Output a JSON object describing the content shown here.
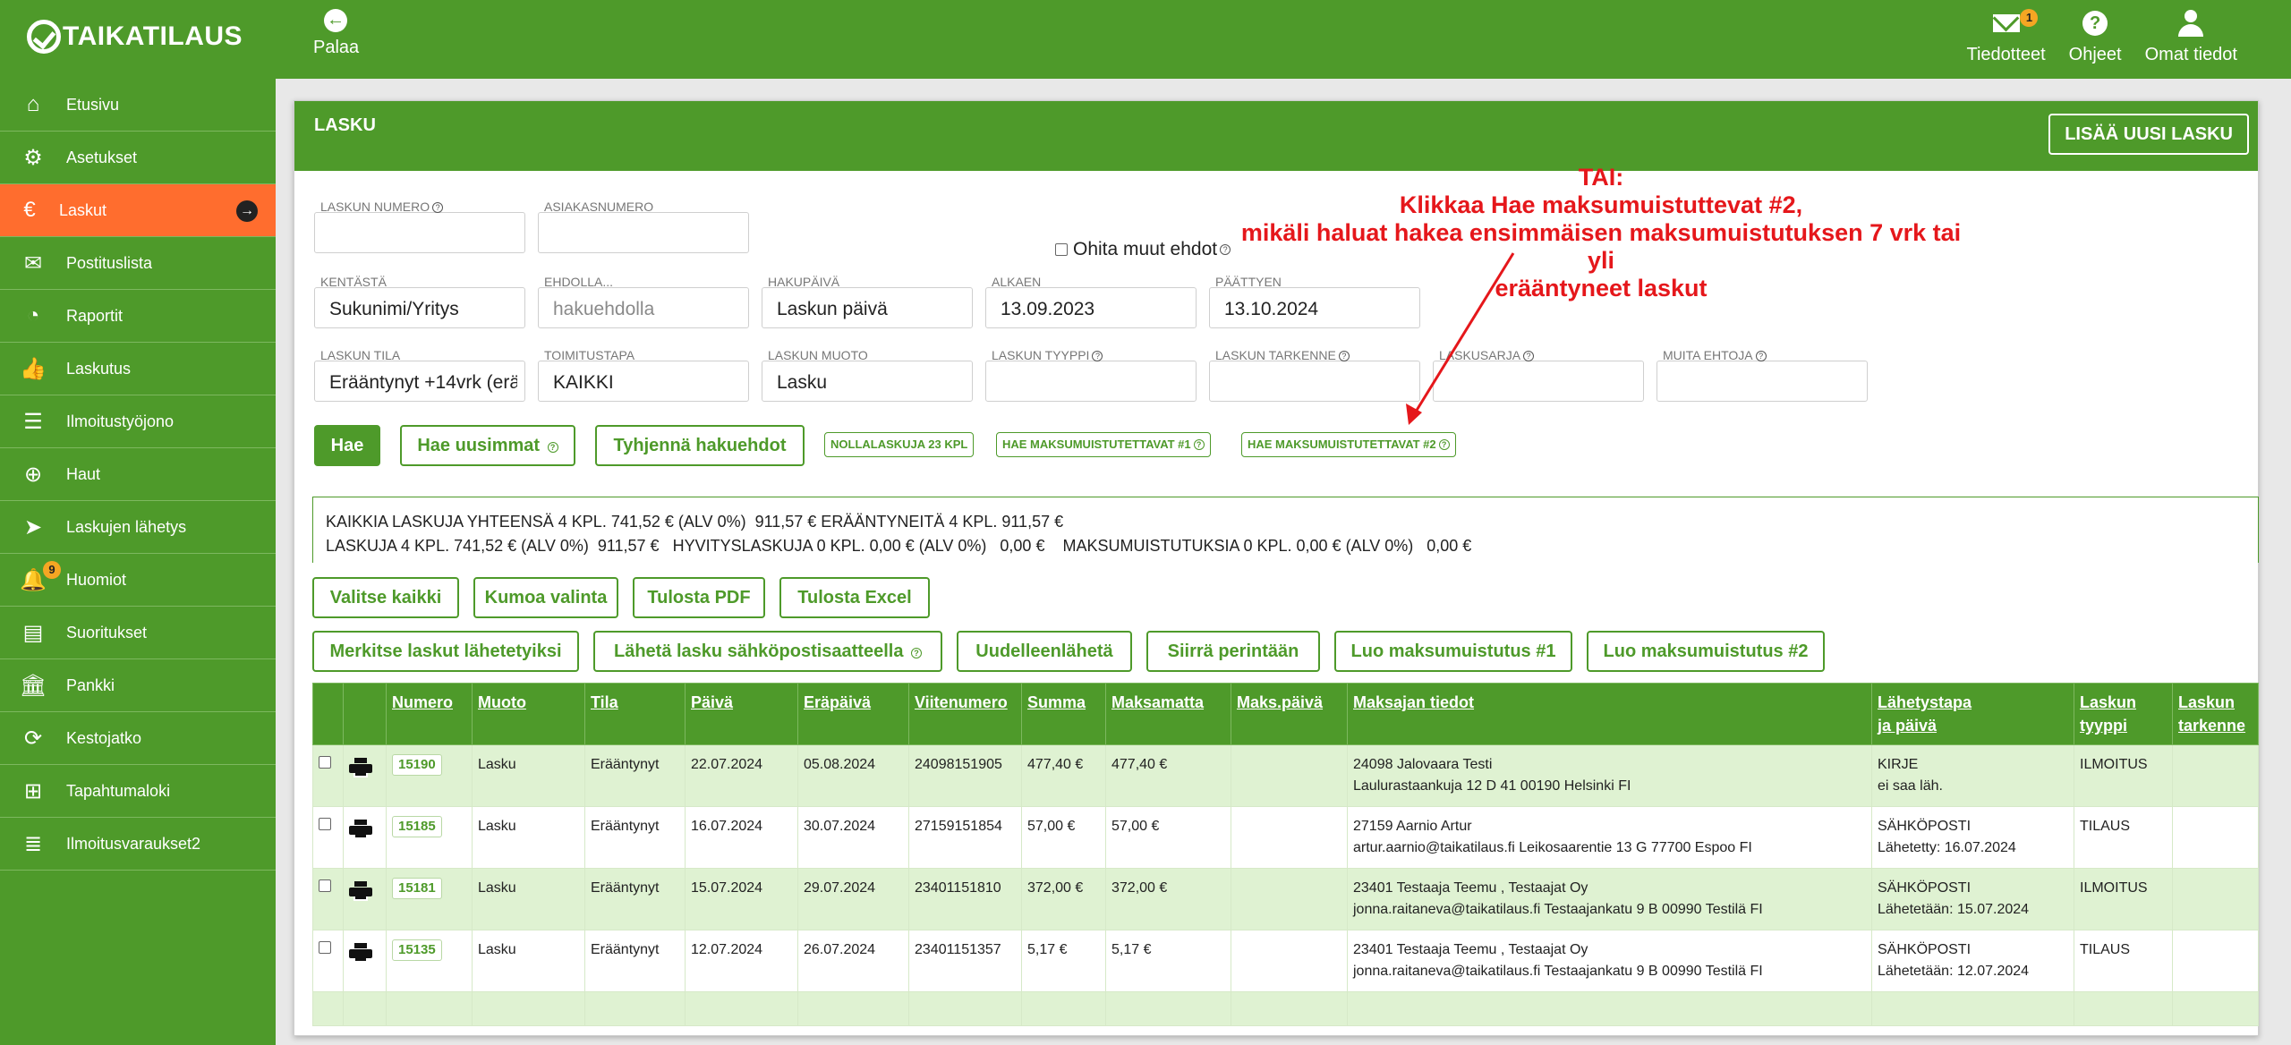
{
  "app": {
    "logo_text": "TAIKATILAUS"
  },
  "topbar": {
    "back_label": "Palaa",
    "actions": [
      {
        "label": "Tiedotteet",
        "icon": "mail-icon",
        "badge": "1"
      },
      {
        "label": "Ohjeet",
        "icon": "help-icon",
        "glyph": "?"
      },
      {
        "label": "Omat tiedot",
        "icon": "user-icon"
      }
    ]
  },
  "sidebar": {
    "items": [
      {
        "label": "Etusivu",
        "icon": "home-icon",
        "glyph": "⌂"
      },
      {
        "label": "Asetukset",
        "icon": "gear-icon",
        "glyph": "⚙"
      },
      {
        "label": "Laskut",
        "icon": "euro-icon",
        "glyph": "€",
        "active": true
      },
      {
        "label": "Postituslista",
        "icon": "envelope-icon",
        "glyph": "✉"
      },
      {
        "label": "Raportit",
        "icon": "pie-chart-icon",
        "glyph": "◔"
      },
      {
        "label": "Laskutus",
        "icon": "thumbs-up-icon",
        "glyph": "👍"
      },
      {
        "label": "Ilmoitustyöjono",
        "icon": "list-icon",
        "glyph": "☰"
      },
      {
        "label": "Haut",
        "icon": "search-plus-icon",
        "glyph": "⊕"
      },
      {
        "label": "Laskujen lähetys",
        "icon": "paper-plane-icon",
        "glyph": "➤"
      },
      {
        "label": "Huomiot",
        "icon": "bell-icon",
        "glyph": "🔔",
        "badge": "9"
      },
      {
        "label": "Suoritukset",
        "icon": "book-icon",
        "glyph": "▤"
      },
      {
        "label": "Pankki",
        "icon": "bank-icon",
        "glyph": "🏛"
      },
      {
        "label": "Kestojatko",
        "icon": "refresh-icon",
        "glyph": "⟳"
      },
      {
        "label": "Tapahtumaloki",
        "icon": "table-icon",
        "glyph": "⊞"
      },
      {
        "label": "Ilmoitusvaraukset2",
        "icon": "list-indent-icon",
        "glyph": "≣"
      }
    ]
  },
  "card": {
    "title": "LASKU",
    "add_button": "LISÄÄ UUSI LASKU"
  },
  "filters": {
    "laskun_numero": {
      "label": "LASKUN NUMERO",
      "value": ""
    },
    "asiakasnumero": {
      "label": "ASIAKASNUMERO",
      "value": ""
    },
    "ohita_label": "Ohita muut ehdot",
    "kentasta": {
      "label": "KENTÄSTÄ",
      "value": "Sukunimi/Yritys"
    },
    "ehdolla": {
      "label": "EHDOLLA...",
      "placeholder": "hakuehdolla"
    },
    "hakupaiva": {
      "label": "HAKUPÄIVÄ",
      "value": "Laskun päivä"
    },
    "alkaen": {
      "label": "ALKAEN",
      "value": "13.09.2023"
    },
    "paattyen": {
      "label": "PÄÄTTYEN",
      "value": "13.10.2024"
    },
    "laskun_tila": {
      "label": "LASKUN TILA",
      "value": "Erääntynyt +14vrk (erä"
    },
    "toimitustapa": {
      "label": "TOIMITUSTAPA",
      "value": "KAIKKI"
    },
    "laskun_muoto": {
      "label": "LASKUN MUOTO",
      "value": "Lasku"
    },
    "laskun_tyyppi": {
      "label": "LASKUN TYYPPI",
      "value": ""
    },
    "laskun_tarkenne": {
      "label": "LASKUN TARKENNE",
      "value": ""
    },
    "laskusarja": {
      "label": "LASKUSARJA",
      "value": ""
    },
    "muita_ehtoja": {
      "label": "MUITA EHTOJA",
      "value": ""
    }
  },
  "search_buttons": {
    "hae": "Hae",
    "hae_uusimmat": "Hae uusimmat",
    "tyhjenna": "Tyhjennä hakuehdot",
    "nollalaskuja": "NOLLALASKUJA 23 KPL",
    "muistutettavat1": "HAE MAKSUMUISTUTETTAVAT #1",
    "muistutettavat2": "HAE MAKSUMUISTUTETTAVAT #2"
  },
  "annotation": {
    "line1": "TAI:",
    "line2": "Klikkaa Hae maksumuistuttevat #2,",
    "line3": "mikäli haluat hakea ensimmäisen maksumuistutuksen 7 vrk tai yli",
    "line4": "erääntyneet laskut",
    "color": "#e5171b"
  },
  "summary": {
    "line1": "KAIKKIA LASKUJA YHTEENSÄ 4 KPL. 741,52 € (ALV 0%)  911,57 € ERÄÄNTYNEITÄ 4 KPL. 911,57 €",
    "line2": "LASKUJA 4 KPL. 741,52 € (ALV 0%)  911,57 €   HYVITYSLASKUJA 0 KPL. 0,00 € (ALV 0%)   0,00 €    MAKSUMUISTUTUKSIA 0 KPL. 0,00 € (ALV 0%)   0,00 €"
  },
  "actions_row1": {
    "valitse": "Valitse kaikki",
    "kumoa": "Kumoa valinta",
    "pdf": "Tulosta PDF",
    "excel": "Tulosta Excel"
  },
  "actions_row2": {
    "merkitse": "Merkitse laskut lähetetyiksi",
    "laheta": "Lähetä lasku sähköpostisaatteella",
    "uudelleen": "Uudelleenlähetä",
    "siirra": "Siirrä perintään",
    "luo1": "Luo maksumuistutus #1",
    "luo2": "Luo maksumuistutus #2"
  },
  "table": {
    "headers": {
      "numero": "Numero",
      "muoto": "Muoto",
      "tila": "Tila",
      "paiva": "Päivä",
      "erapaiva": "Eräpäivä",
      "viitenumero": "Viitenumero",
      "summa": "Summa",
      "maksamatta": "Maksamatta",
      "makspaiva": "Maks.päivä",
      "maksajan": "Maksajan tiedot",
      "lahetystapa1": "Lähetystapa",
      "lahetystapa2": "ja päivä",
      "tyyppi1": "Laskun",
      "tyyppi2": "tyyppi",
      "tarkenne1": "Laskun",
      "tarkenne2": "tarkenne"
    },
    "rows": [
      {
        "numero": "15190",
        "muoto": "Lasku",
        "tila": "Erääntynyt",
        "paiva": "22.07.2024",
        "erapaiva": "05.08.2024",
        "viite": "24098151905",
        "summa": "477,40 €",
        "maksamatta": "477,40 €",
        "makspaiva": "",
        "maksaja1": "24098 Jalovaara Testi",
        "maksaja2": "Laulurastaankuja 12 D 41 00190 Helsinki FI",
        "tapa1": "KIRJE",
        "tapa2": "ei saa läh.",
        "tyyppi": "ILMOITUS",
        "tarkenne": ""
      },
      {
        "numero": "15185",
        "muoto": "Lasku",
        "tila": "Erääntynyt",
        "paiva": "16.07.2024",
        "erapaiva": "30.07.2024",
        "viite": "27159151854",
        "summa": "57,00 €",
        "maksamatta": "57,00 €",
        "makspaiva": "",
        "maksaja1": "27159 Aarnio Artur",
        "maksaja2": "artur.aarnio@taikatilaus.fi Leikosaarentie 13 G 77700 Espoo FI",
        "tapa1": "SÄHKÖPOSTI",
        "tapa2": "Lähetetty: 16.07.2024",
        "tyyppi": "TILAUS",
        "tarkenne": ""
      },
      {
        "numero": "15181",
        "muoto": "Lasku",
        "tila": "Erääntynyt",
        "paiva": "15.07.2024",
        "erapaiva": "29.07.2024",
        "viite": "23401151810",
        "summa": "372,00 €",
        "maksamatta": "372,00 €",
        "makspaiva": "",
        "maksaja1": "23401 Testaaja Teemu , Testaajat Oy",
        "maksaja2": "jonna.raitaneva@taikatilaus.fi Testaajankatu 9 B 00990 Testilä FI",
        "tapa1": "SÄHKÖPOSTI",
        "tapa2": "Lähetetään: 15.07.2024",
        "tyyppi": "ILMOITUS",
        "tarkenne": ""
      },
      {
        "numero": "15135",
        "muoto": "Lasku",
        "tila": "Erääntynyt",
        "paiva": "12.07.2024",
        "erapaiva": "26.07.2024",
        "viite": "23401151357",
        "summa": "5,17 €",
        "maksamatta": "5,17 €",
        "makspaiva": "",
        "maksaja1": "23401 Testaaja Teemu , Testaajat Oy",
        "maksaja2": "jonna.raitaneva@taikatilaus.fi Testaajankatu 9 B 00990 Testilä FI",
        "tapa1": "SÄHKÖPOSTI",
        "tapa2": "Lähetetään: 12.07.2024",
        "tyyppi": "TILAUS",
        "tarkenne": ""
      }
    ]
  },
  "colors": {
    "brand_green": "#4e9a2a",
    "active_orange": "#ff6d2e",
    "row_alt": "#dff2d2",
    "annotation_red": "#e5171b"
  }
}
